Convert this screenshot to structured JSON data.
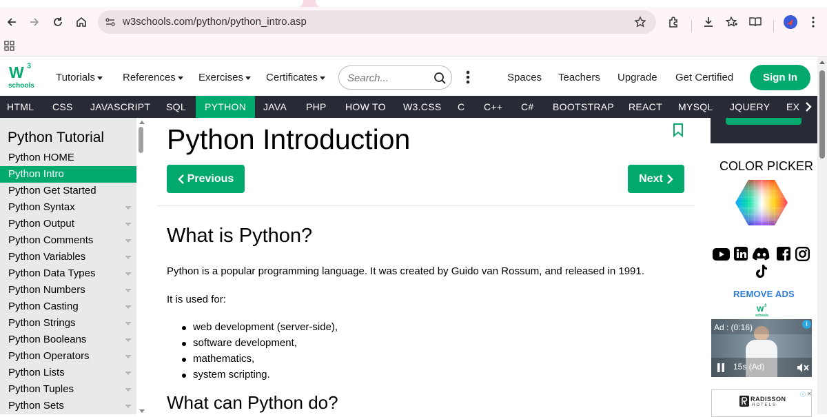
{
  "browser": {
    "url": "w3schools.com/python/python_intro.asp"
  },
  "header": {
    "logo_top": "W",
    "logo_sup": "3",
    "logo_bottom": "schools",
    "menus": [
      "Tutorials",
      "References",
      "Exercises",
      "Certificates"
    ],
    "search_placeholder": "Search...",
    "links": [
      "Spaces",
      "Teachers",
      "Upgrade",
      "Get Certified"
    ],
    "sign_in": "Sign In"
  },
  "topnav": [
    "HTML",
    "CSS",
    "JAVASCRIPT",
    "SQL",
    "PYTHON",
    "JAVA",
    "PHP",
    "HOW TO",
    "W3.CSS",
    "C",
    "C++",
    "C#",
    "BOOTSTRAP",
    "REACT",
    "MYSQL",
    "JQUERY",
    "EX"
  ],
  "sidebar": {
    "title": "Python Tutorial",
    "items": [
      "Python HOME",
      "Python Intro",
      "Python Get Started",
      "Python Syntax",
      "Python Output",
      "Python Comments",
      "Python Variables",
      "Python Data Types",
      "Python Numbers",
      "Python Casting",
      "Python Strings",
      "Python Booleans",
      "Python Operators",
      "Python Lists",
      "Python Tuples",
      "Python Sets"
    ]
  },
  "main": {
    "title": "Python Introduction",
    "prev": "Previous",
    "next": "Next",
    "h2_what": "What is Python?",
    "p1": "Python is a popular programming language. It was created by Guido van Rossum, and released in 1991.",
    "p2": "It is used for:",
    "uses": [
      "web development (server-side),",
      "software development,",
      "mathematics,",
      "system scripting."
    ],
    "h2_can": "What can Python do?"
  },
  "right": {
    "color_picker": "COLOR PICKER",
    "remove_ads": "REMOVE ADS",
    "mini_logo": "W",
    "mini_logo_sub": "schools",
    "ad_label": "Ad : (0:16)",
    "ad_time": "15s (Ad)",
    "hotel_name": "RADISSON",
    "hotel_sub": "HOTELS"
  },
  "colors": {
    "accent": "#04aa6d",
    "topnav_bg": "#282a35",
    "sidebar_bg": "#e7e9eb",
    "remove_ads": "#2b7bd6"
  }
}
